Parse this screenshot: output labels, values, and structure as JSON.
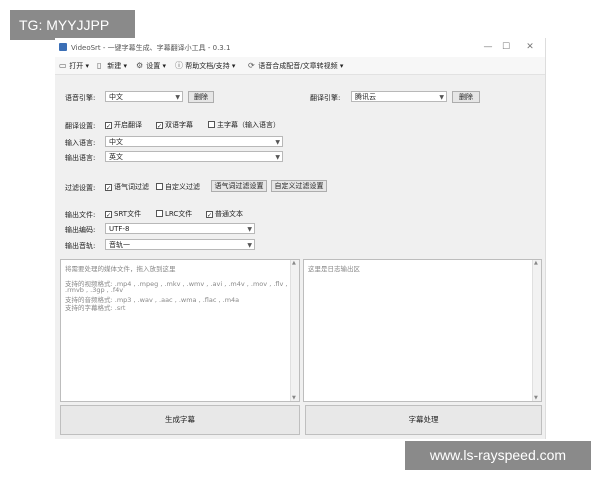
{
  "overlay": {
    "tg": "TG: MYYJJPP",
    "watermark": "www.ls-rayspeed.com"
  },
  "window": {
    "title": "VideoSrt - 一键字幕生成、字幕翻译小工具 - 0.3.1",
    "min": "—",
    "max": "☐",
    "close": "✕"
  },
  "menu": {
    "open": "打开",
    "new": "新建",
    "settings": "设置",
    "help": "帮助文档/支持",
    "tts": "语音合成配音/文章转视频"
  },
  "engine": {
    "label": "语音引擎:",
    "value": "中文",
    "delete": "删除",
    "trans_label": "翻译引擎:",
    "trans_value": "腾讯云",
    "trans_delete": "删除"
  },
  "translate": {
    "label": "翻译设置:",
    "enable": "开启翻译",
    "bilingual": "双语字幕",
    "main": "主字幕（输入语言）",
    "input_label": "输入语言:",
    "input_value": "中文",
    "output_label": "输出语言:",
    "output_value": "英文"
  },
  "filter": {
    "label": "过滤设置:",
    "mood": "语气词过滤",
    "custom": "自定义过滤",
    "mood_btn": "语气词过滤设置",
    "custom_btn": "自定义过滤设置"
  },
  "output": {
    "label": "输出文件:",
    "srt": "SRT文件",
    "lrc": "LRC文件",
    "txt": "普通文本",
    "enc_label": "输出编码:",
    "enc_value": "UTF-8",
    "track_label": "输出音轨:",
    "track_value": "音轨一"
  },
  "left_text": {
    "l1": "将需要处理的媒体文件，拖入放到这里",
    "l2": "支持的视频格式: .mp4 , .mpeg , .mkv , .wmv , .avi , .m4v , .mov , .flv ,",
    "l3": ".rmvb , .3gp , .f4v",
    "l4": "支持的音频格式: .mp3 , .wav , .aac , .wma , .flac , .m4a",
    "l5": "支持的字幕格式: .srt"
  },
  "right_text": {
    "l1": "这里是日志输出区"
  },
  "buttons": {
    "generate": "生成字幕",
    "process": "字幕处理"
  }
}
